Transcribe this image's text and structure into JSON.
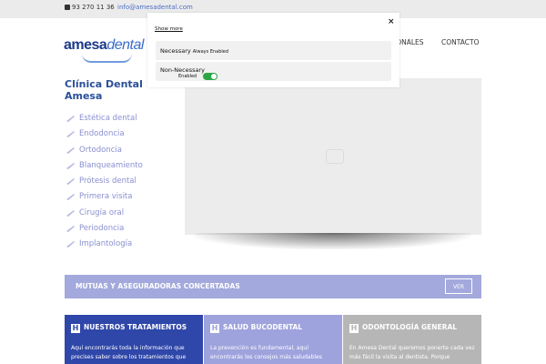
{
  "topbar": {
    "phone": "93 270 11 36",
    "email": "info@amesadental.com"
  },
  "logo": {
    "part1": "amesa",
    "part2": "dental"
  },
  "nav": {
    "item_partial": "IONALES",
    "contacto": "CONTACTO"
  },
  "sidebar": {
    "title": "Clínica Dental Amesa",
    "items": [
      {
        "label": "Estética dental"
      },
      {
        "label": "Endodoncia"
      },
      {
        "label": "Ortodoncia"
      },
      {
        "label": "Blanqueamiento"
      },
      {
        "label": "Prótesis dental"
      },
      {
        "label": "Primera visita"
      },
      {
        "label": "Cirugía oral"
      },
      {
        "label": "Periodoncia"
      },
      {
        "label": "Implantología"
      }
    ]
  },
  "mutuas": {
    "title": "MUTUAS Y ASEGURADORAS CONCERTADAS",
    "button": "VER"
  },
  "cards": [
    {
      "icon": "H",
      "title": "NUESTROS TRATAMIENTOS",
      "text": "Aquí encontrarás toda la información que precises saber sobre los tratamientos que"
    },
    {
      "icon": "H",
      "title": "SALUD BUCODENTAL",
      "text": "La prevención es fundamental, aquí encontrarás los consejos más saludables"
    },
    {
      "icon": "H",
      "title": "ODONTOLOGÍA GENERAL",
      "text": "En Amesa Dental queremos ponerte cada vez más fácil la visita al dentista. Porque"
    }
  ],
  "cookie_modal": {
    "close": "×",
    "show_more": "Show more",
    "necessary": "Necessary",
    "always_enabled": "Always Enabled",
    "non_necessary": "Non-Necessary",
    "enabled": "Enabled",
    "toggle_on": true
  },
  "colors": {
    "brand_dark": "#2f47a9",
    "brand_light": "#9ea3dd",
    "menu_text": "#8a90d0",
    "toggle_green": "#2aa744"
  }
}
